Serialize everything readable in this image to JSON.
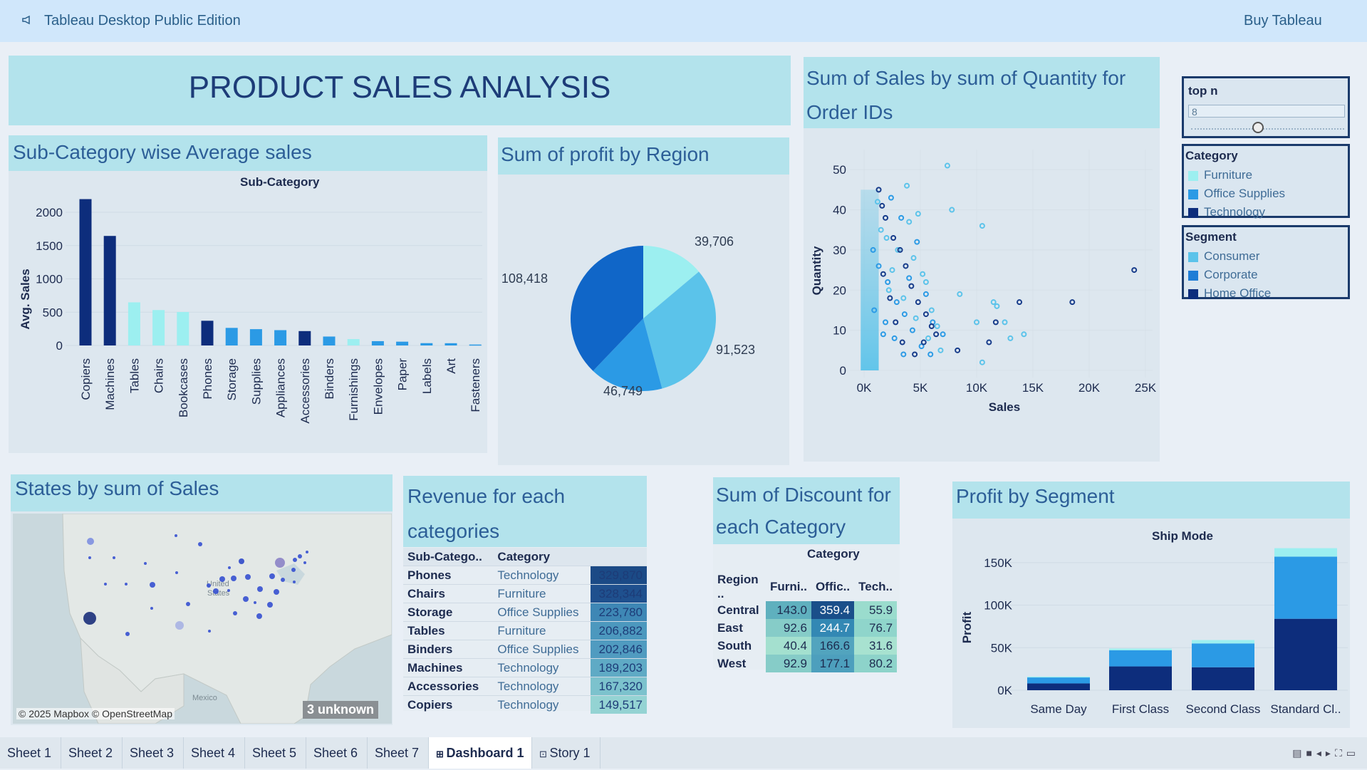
{
  "topbar": {
    "app_title": "Tableau Desktop Public Edition",
    "buy_label": "Buy Tableau"
  },
  "dashboard": {
    "title": "PRODUCT SALES ANALYSIS"
  },
  "avg_sales": {
    "header": "Sub-Category wise Average sales",
    "column_label": "Sub-Category",
    "y_label": "Avg. Sales",
    "chart_data": {
      "type": "bar",
      "categories": [
        "Copiers",
        "Machines",
        "Tables",
        "Chairs",
        "Bookcases",
        "Phones",
        "Storage",
        "Supplies",
        "Appliances",
        "Accessories",
        "Binders",
        "Furnishings",
        "Envelopes",
        "Paper",
        "Labels",
        "Art",
        "Fasteners"
      ],
      "values": [
        2198,
        1645,
        648,
        532,
        503,
        371,
        264,
        245,
        230,
        216,
        134,
        96,
        65,
        57,
        35,
        34,
        14
      ],
      "category_of_bar": [
        "Technology",
        "Technology",
        "Furniture",
        "Furniture",
        "Furniture",
        "Technology",
        "Office Supplies",
        "Office Supplies",
        "Office Supplies",
        "Technology",
        "Office Supplies",
        "Furniture",
        "Office Supplies",
        "Office Supplies",
        "Office Supplies",
        "Office Supplies",
        "Office Supplies"
      ],
      "y_ticks": [
        "0",
        "500",
        "1000",
        "1500",
        "2000"
      ],
      "ylim": [
        0,
        2300
      ]
    }
  },
  "profit_region": {
    "header": "Sum of profit by Region",
    "chart_data": {
      "type": "pie",
      "slices": [
        {
          "label": "39,706",
          "value": 39706,
          "color": "#9ceff0"
        },
        {
          "label": "91,523",
          "value": 91523,
          "color": "#5bc3ea"
        },
        {
          "label": "46,749",
          "value": 46749,
          "color": "#2b9ae5"
        },
        {
          "label": "108,418",
          "value": 108418,
          "color": "#1066c8"
        }
      ]
    }
  },
  "scatter": {
    "header_line1": "Sum of Sales by sum of Quantity for",
    "header_line2": "Order IDs",
    "x_label": "Sales",
    "y_label": "Quantity",
    "chart_data": {
      "type": "scatter",
      "xlim": [
        0,
        25000
      ],
      "ylim": [
        0,
        55
      ],
      "x_ticks": [
        "0K",
        "5K",
        "10K",
        "15K",
        "20K",
        "25K"
      ],
      "y_ticks": [
        "0",
        "10",
        "20",
        "30",
        "40",
        "50"
      ],
      "series": [
        {
          "name": "Furniture",
          "color": "#5bc3ea",
          "points": [
            [
              7400,
              51
            ],
            [
              7800,
              40
            ],
            [
              10500,
              36
            ],
            [
              8500,
              19
            ],
            [
              11800,
              16
            ],
            [
              12500,
              12
            ],
            [
              10000,
              12
            ],
            [
              11500,
              17
            ],
            [
              13000,
              8
            ],
            [
              14200,
              9
            ],
            [
              10500,
              2
            ],
            [
              5500,
              22
            ],
            [
              4800,
              39
            ],
            [
              3800,
              46
            ],
            [
              4000,
              37
            ],
            [
              3000,
              30
            ],
            [
              5200,
              24
            ],
            [
              6000,
              15
            ],
            [
              6500,
              11
            ],
            [
              4400,
              28
            ],
            [
              2000,
              33
            ],
            [
              2500,
              25
            ],
            [
              3500,
              18
            ],
            [
              4600,
              13
            ],
            [
              5700,
              8
            ],
            [
              6800,
              5
            ],
            [
              1200,
              42
            ],
            [
              1500,
              35
            ],
            [
              2200,
              20
            ]
          ]
        },
        {
          "name": "Office Supplies",
          "color": "#2b9ae5",
          "points": [
            [
              800,
              30
            ],
            [
              1300,
              26
            ],
            [
              2100,
              22
            ],
            [
              2900,
              17
            ],
            [
              3600,
              14
            ],
            [
              4300,
              10
            ],
            [
              5100,
              6
            ],
            [
              1900,
              12
            ],
            [
              2700,
              8
            ],
            [
              3500,
              4
            ],
            [
              4000,
              23
            ],
            [
              5500,
              19
            ],
            [
              4700,
              32
            ],
            [
              3300,
              38
            ],
            [
              2400,
              43
            ],
            [
              1700,
              9
            ],
            [
              900,
              15
            ],
            [
              6100,
              12
            ],
            [
              7000,
              9
            ],
            [
              5900,
              4
            ]
          ]
        },
        {
          "name": "Technology",
          "color": "#163b8a",
          "points": [
            [
              24000,
              25
            ],
            [
              18500,
              17
            ],
            [
              13800,
              17
            ],
            [
              11700,
              12
            ],
            [
              11100,
              7
            ],
            [
              8300,
              5
            ],
            [
              1300,
              45
            ],
            [
              1600,
              41
            ],
            [
              1900,
              38
            ],
            [
              2600,
              33
            ],
            [
              3200,
              30
            ],
            [
              3700,
              26
            ],
            [
              4200,
              21
            ],
            [
              4800,
              17
            ],
            [
              5500,
              14
            ],
            [
              6000,
              11
            ],
            [
              6400,
              9
            ],
            [
              5300,
              7
            ],
            [
              4500,
              4
            ],
            [
              3400,
              7
            ],
            [
              2800,
              12
            ],
            [
              2300,
              18
            ],
            [
              1700,
              24
            ]
          ]
        }
      ]
    }
  },
  "category_legend": {
    "title": "Category",
    "items": [
      {
        "label": "Furniture",
        "color": "#9ceff0"
      },
      {
        "label": "Office Supplies",
        "color": "#2b9ae5"
      },
      {
        "label": "Technology",
        "color": "#0d2d7c"
      }
    ]
  },
  "segment_legend": {
    "title": "Segment",
    "items": [
      {
        "label": "Consumer",
        "color": "#5bc3ea"
      },
      {
        "label": "Corporate",
        "color": "#1f7dd6"
      },
      {
        "label": "Home Office",
        "color": "#0d2d7c"
      }
    ]
  },
  "top_n": {
    "title": "top n",
    "value": "8",
    "slider_fraction": 0.4
  },
  "map": {
    "header": "States by sum of Sales",
    "attribution": "© 2025 Mapbox © OpenStreetMap",
    "unknown_badge": "3 unknown",
    "country_labels": [
      "United",
      "States",
      "Mexico"
    ]
  },
  "revenue": {
    "header_line1": "Revenue for each",
    "header_line2": "categories",
    "columns": [
      "Sub-Catego..",
      "Category"
    ],
    "rows": [
      {
        "sub": "Phones",
        "cat": "Technology",
        "val": "329,870",
        "shade": "#1b4a86"
      },
      {
        "sub": "Chairs",
        "cat": "Furniture",
        "val": "328,344",
        "shade": "#1f508e"
      },
      {
        "sub": "Storage",
        "cat": "Office Supplies",
        "val": "223,780",
        "shade": "#3e87b5"
      },
      {
        "sub": "Tables",
        "cat": "Furniture",
        "val": "206,882",
        "shade": "#4c98be"
      },
      {
        "sub": "Binders",
        "cat": "Office Supplies",
        "val": "202,846",
        "shade": "#509bc0"
      },
      {
        "sub": "Machines",
        "cat": "Technology",
        "val": "189,203",
        "shade": "#5faac5"
      },
      {
        "sub": "Accessories",
        "cat": "Technology",
        "val": "167,320",
        "shade": "#7cc2cd"
      },
      {
        "sub": "Copiers",
        "cat": "Technology",
        "val": "149,517",
        "shade": "#94d3d3"
      }
    ]
  },
  "discount": {
    "header_line1": "Sum of Discount for",
    "header_line2": "each Category",
    "col_group": "Category",
    "columns": [
      "Region ..",
      "Furni..",
      "Offic..",
      "Tech.."
    ],
    "rows": [
      {
        "region": "Central",
        "vals": [
          "143.0",
          "359.4",
          "55.9"
        ],
        "shades": [
          "#5fb0be",
          "#1a4f8a",
          "#9adccd"
        ]
      },
      {
        "region": "East",
        "vals": [
          "92.6",
          "244.7",
          "76.7"
        ],
        "shades": [
          "#86ccc8",
          "#3388b4",
          "#8fd5cb"
        ]
      },
      {
        "region": "South",
        "vals": [
          "40.4",
          "166.6",
          "31.6"
        ],
        "shades": [
          "#a4e0cf",
          "#52a4be",
          "#a8e2d0"
        ]
      },
      {
        "region": "West",
        "vals": [
          "92.9",
          "177.1",
          "80.2"
        ],
        "shades": [
          "#86ccc8",
          "#4d9fbd",
          "#8dd3ca"
        ]
      }
    ]
  },
  "profit_segment": {
    "header": "Profit by Segment",
    "column_label": "Ship Mode",
    "y_label": "Profit",
    "chart_data": {
      "type": "bar",
      "stacked": true,
      "categories": [
        "Same Day",
        "First Class",
        "Second Class",
        "Standard Cl.."
      ],
      "y_ticks": [
        "0K",
        "50K",
        "100K",
        "150K"
      ],
      "ylim": [
        0,
        170000
      ],
      "series": [
        {
          "name": "Home Office",
          "color": "#0d2d7c",
          "values": [
            8000,
            28000,
            27000,
            84000
          ]
        },
        {
          "name": "Corporate",
          "color": "#2b9ae5",
          "values": [
            7000,
            19000,
            28000,
            73000
          ]
        },
        {
          "name": "Consumer",
          "color": "#9ceff0",
          "values": [
            1000,
            2000,
            4000,
            10000
          ]
        }
      ]
    }
  },
  "tabs": [
    "Sheet 1",
    "Sheet 2",
    "Sheet 3",
    "Sheet 4",
    "Sheet 5",
    "Sheet 6",
    "Sheet 7",
    "Dashboard 1",
    "Story 1"
  ]
}
